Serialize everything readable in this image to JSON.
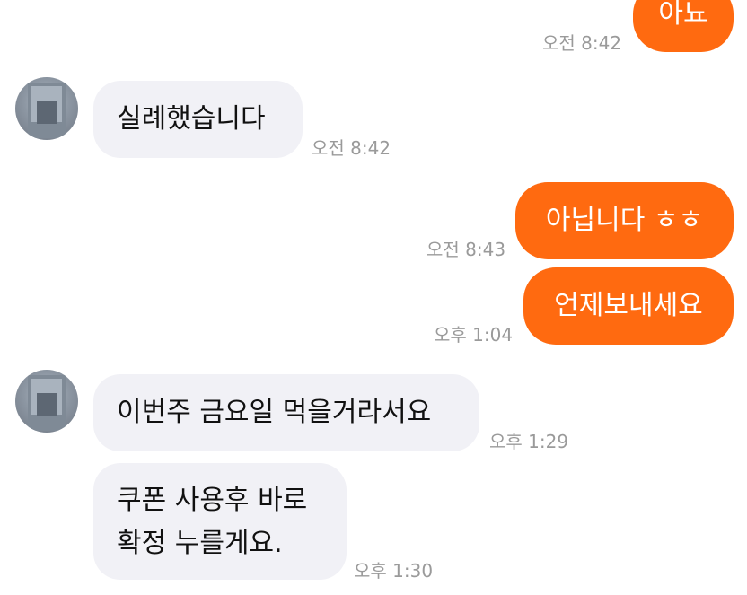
{
  "messages": [
    {
      "direction": "out",
      "text": "아뇨",
      "time": "오전 8:42"
    },
    {
      "direction": "in",
      "text": "실례했습니다",
      "time": "오전 8:42"
    },
    {
      "direction": "out",
      "text": "아닙니다 ㅎㅎ",
      "time": "오전 8:43"
    },
    {
      "direction": "out",
      "text": "언제보내세요",
      "time": "오후 1:04"
    },
    {
      "direction": "in",
      "text": "이번주 금요일 먹을거라서요",
      "time": "오후 1:29"
    },
    {
      "direction": "in",
      "lines": [
        "쿠폰 사용후 바로",
        "확정 누를게요."
      ],
      "time": "오후 1:30"
    }
  ],
  "colors": {
    "outgoing_bubble": "#ff6a10",
    "incoming_bubble": "#f1f1f6",
    "timestamp": "#9a9a9a"
  },
  "icons": {
    "contact_avatar": "contact-avatar"
  }
}
